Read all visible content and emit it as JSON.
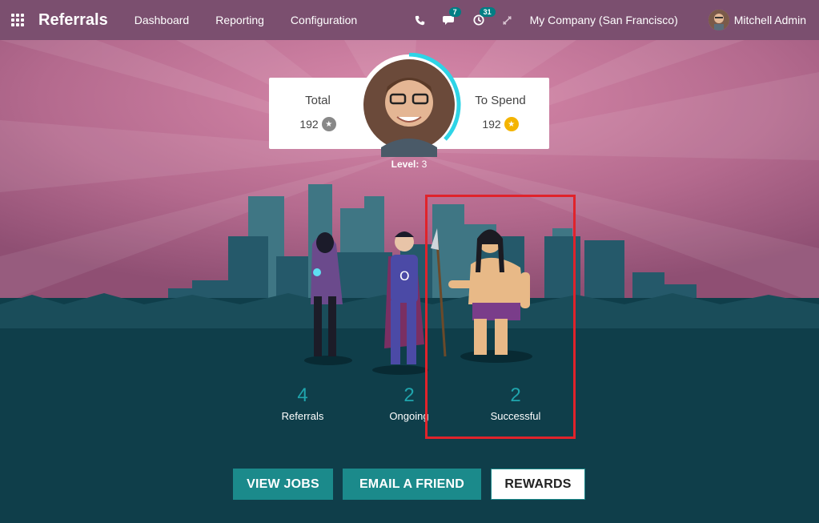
{
  "app": {
    "title": "Referrals"
  },
  "nav": {
    "items": [
      {
        "label": "Dashboard"
      },
      {
        "label": "Reporting"
      },
      {
        "label": "Configuration"
      }
    ]
  },
  "systray": {
    "messages_count": "7",
    "activities_count": "31",
    "company": "My Company (San Francisco)",
    "user": "Mitchell Admin"
  },
  "points": {
    "total_label": "Total",
    "total_value": "192",
    "spend_label": "To Spend",
    "spend_value": "192"
  },
  "level": {
    "prefix": "Level:",
    "value": "3"
  },
  "stats": [
    {
      "num": "4",
      "caption": "Referrals"
    },
    {
      "num": "2",
      "caption": "Ongoing"
    },
    {
      "num": "2",
      "caption": "Successful"
    }
  ],
  "buttons": {
    "view_jobs": "VIEW JOBS",
    "email_friend": "EMAIL A FRIEND",
    "rewards": "REWARDS"
  },
  "colors": {
    "navbar": "#7b4f6f",
    "accent": "#1b8a8b",
    "highlight": "#e0232b",
    "dark": "#0f3e4a"
  }
}
